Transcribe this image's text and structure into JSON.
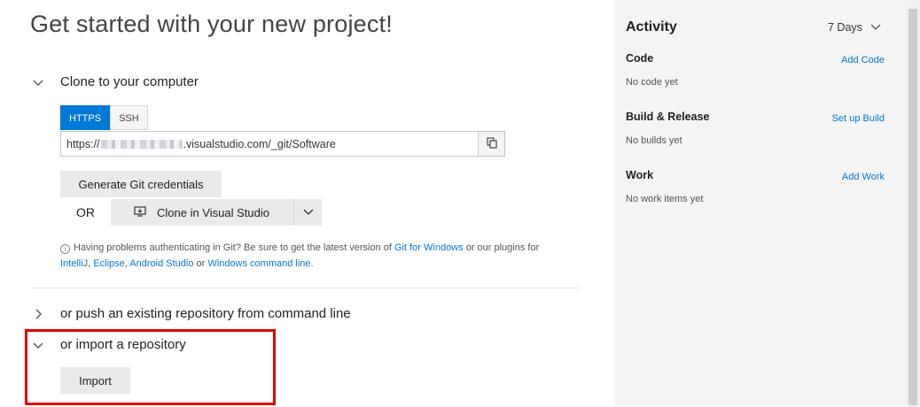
{
  "page": {
    "title": "Get started with your new project!"
  },
  "clone": {
    "header": "Clone to your computer",
    "tabs": [
      {
        "label": "HTTPS",
        "active": true
      },
      {
        "label": "SSH",
        "active": false
      }
    ],
    "url_prefix": "https://",
    "url_suffix": ".visualstudio.com/_git/Software",
    "copy_icon": "copy-icon",
    "generate_credentials_label": "Generate Git credentials",
    "or_label": "OR",
    "clone_vs_label": "Clone in Visual Studio",
    "help": {
      "line1_text": "Having problems authenticating in Git? Be sure to get the latest version of",
      "git_for_windows": "Git for Windows",
      "line1_tail": "or our plugins for",
      "intellij": "IntelliJ",
      "sep1": ",",
      "eclipse": "Eclipse",
      "sep2": ",",
      "android_studio": "Android Studio",
      "or_text": "or",
      "windows_cmd": "Windows command line",
      "end": "."
    }
  },
  "push": {
    "header": "or push an existing repository from command line"
  },
  "import": {
    "header": "or import a repository",
    "button_label": "Import"
  },
  "activity": {
    "title": "Activity",
    "range": "7 Days",
    "rows": [
      {
        "title": "Code",
        "link": "Add Code",
        "status": "No code yet"
      },
      {
        "title": "Build & Release",
        "link": "Set up Build",
        "status": "No builds yet"
      },
      {
        "title": "Work",
        "link": "Add Work",
        "status": "No work items yet"
      }
    ]
  },
  "colors": {
    "accent": "#0078d7",
    "highlight": "#e00000",
    "panel_bg": "#f4f4f4"
  }
}
